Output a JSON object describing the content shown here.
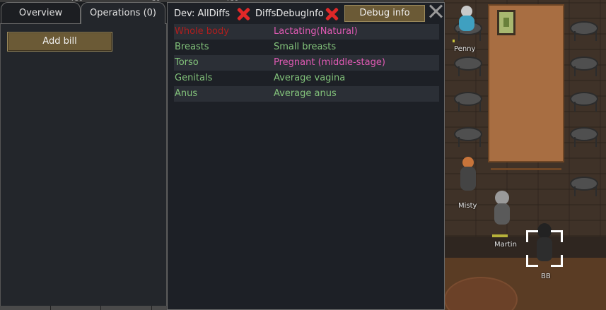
{
  "tabs": {
    "overview": "Overview",
    "operations": "Operations (0)"
  },
  "left_panel": {
    "add_bill": "Add bill"
  },
  "ruler": [
    "750",
    "30",
    "750"
  ],
  "debug_window": {
    "dev_label": "Dev: AllDiffs",
    "diffs_label": "DiffsDebugInfo",
    "debug_info_button": "Debug info",
    "rows": [
      {
        "part": "Whole body",
        "diff": "Lactating(Natural)",
        "part_color": "#b01e1e",
        "diff_color": "#e05ab4"
      },
      {
        "part": "Breasts",
        "diff": "Small breasts",
        "part_color": "#82c27a",
        "diff_color": "#82c27a"
      },
      {
        "part": "Torso",
        "diff": "Pregnant (middle-stage)",
        "part_color": "#82c27a",
        "diff_color": "#e05ab4"
      },
      {
        "part": "Genitals",
        "diff": "Average vagina",
        "part_color": "#82c27a",
        "diff_color": "#82c27a"
      },
      {
        "part": "Anus",
        "diff": "Average anus",
        "part_color": "#82c27a",
        "diff_color": "#82c27a"
      }
    ]
  },
  "pawns": {
    "penny": "Penny",
    "misty": "Misty",
    "martin": "Martin",
    "bb": "BB"
  },
  "colors": {
    "button_bg": "#6b5a36",
    "panel_bg": "#23262b",
    "table_wood": "#a86e42"
  }
}
